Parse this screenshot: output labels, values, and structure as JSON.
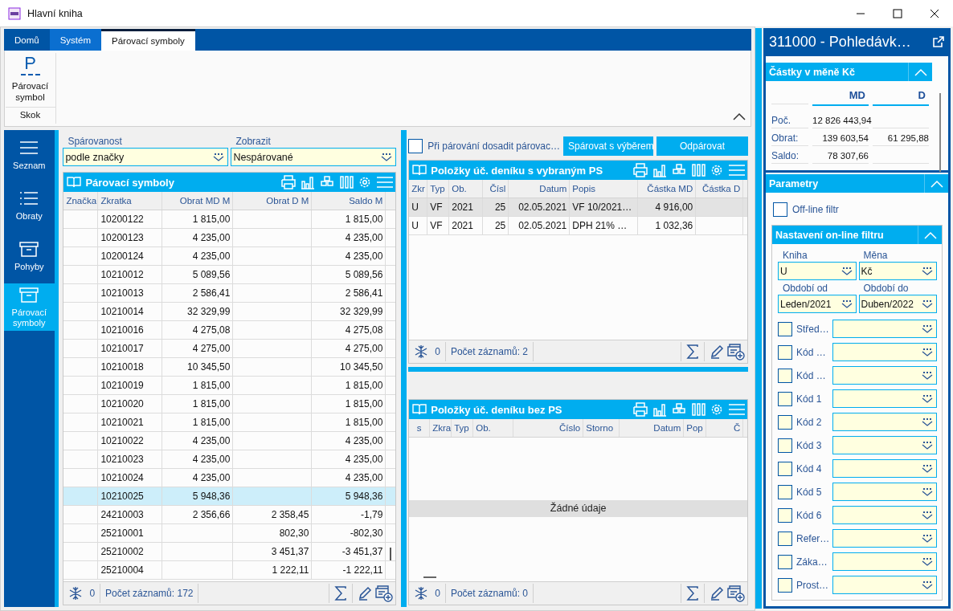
{
  "window": {
    "title": "Hlavní kniha"
  },
  "ribbon": {
    "tabs": [
      {
        "label": "Domů",
        "selected": false,
        "hovered": false
      },
      {
        "label": "Systém",
        "selected": false,
        "hovered": true
      },
      {
        "label": "Párovací symboly",
        "selected": true,
        "hovered": false
      }
    ],
    "groups": [
      {
        "label": "Skok",
        "buttons": [
          {
            "label": "Párovací symbol",
            "icon_text": "P"
          }
        ]
      }
    ]
  },
  "navigation": [
    {
      "label": "Seznam",
      "selected": false
    },
    {
      "label": "Obraty",
      "selected": false
    },
    {
      "label": "Pohyby",
      "selected": false
    },
    {
      "label": "Párovací symboly",
      "selected": true
    }
  ],
  "filters": [
    {
      "label": "Spárovanost",
      "value": "podle značky"
    },
    {
      "label": "Zobrazit",
      "value": "Nespárované"
    }
  ],
  "main_grid": {
    "title": "Párovací symboly",
    "columns": [
      "Značka",
      "Zkratka",
      "Obrat MD M",
      "Obrat D M",
      "Saldo M"
    ],
    "rows": [
      {
        "cells": [
          null,
          "10200122",
          "1 815,00",
          null,
          "1 815,00"
        ],
        "selected": false
      },
      {
        "cells": [
          null,
          "10200123",
          "4 235,00",
          null,
          "4 235,00"
        ],
        "selected": false
      },
      {
        "cells": [
          null,
          "10200124",
          "4 235,00",
          null,
          "4 235,00"
        ],
        "selected": false
      },
      {
        "cells": [
          null,
          "10210012",
          "5 089,56",
          null,
          "5 089,56"
        ],
        "selected": false
      },
      {
        "cells": [
          null,
          "10210013",
          "2 586,41",
          null,
          "2 586,41"
        ],
        "selected": false
      },
      {
        "cells": [
          null,
          "10210014",
          "32 329,99",
          null,
          "32 329,99"
        ],
        "selected": false
      },
      {
        "cells": [
          null,
          "10210016",
          "4 275,08",
          null,
          "4 275,08"
        ],
        "selected": false
      },
      {
        "cells": [
          null,
          "10210017",
          "4 275,00",
          null,
          "4 275,00"
        ],
        "selected": false
      },
      {
        "cells": [
          null,
          "10210018",
          "10 345,50",
          null,
          "10 345,50"
        ],
        "selected": false
      },
      {
        "cells": [
          null,
          "10210019",
          "1 815,00",
          null,
          "1 815,00"
        ],
        "selected": false
      },
      {
        "cells": [
          null,
          "10210020",
          "1 815,00",
          null,
          "1 815,00"
        ],
        "selected": false
      },
      {
        "cells": [
          null,
          "10210021",
          "1 815,00",
          null,
          "1 815,00"
        ],
        "selected": false
      },
      {
        "cells": [
          null,
          "10210022",
          "4 235,00",
          null,
          "4 235,00"
        ],
        "selected": false
      },
      {
        "cells": [
          null,
          "10210023",
          "4 235,00",
          null,
          "4 235,00"
        ],
        "selected": false
      },
      {
        "cells": [
          null,
          "10210024",
          "4 235,00",
          null,
          "4 235,00"
        ],
        "selected": false
      },
      {
        "cells": [
          null,
          "10210025",
          "5 948,36",
          null,
          "5 948,36"
        ],
        "selected": true
      },
      {
        "cells": [
          null,
          "24210003",
          "2 356,66",
          "2 358,45",
          "-1,79"
        ],
        "selected": false
      },
      {
        "cells": [
          null,
          "25210001",
          null,
          "802,30",
          "-802,30"
        ],
        "selected": false
      },
      {
        "cells": [
          null,
          "25210002",
          null,
          "3 451,37",
          "-3 451,37"
        ],
        "selected": false
      },
      {
        "cells": [
          null,
          "25210004",
          null,
          "1 222,11",
          "-1 222,11"
        ],
        "selected": false
      }
    ],
    "footer": {
      "count": "0",
      "records": "Počet záznamů: 172"
    }
  },
  "pairing": {
    "checkbox": {
      "label": "Při párování dosadit párovac…",
      "checked": false
    },
    "buttons": [
      "Spárovat s výběrem",
      "Odpárovat"
    ]
  },
  "selected_items_grid": {
    "title": "Položky úč. deníku s vybraným PS",
    "columns": [
      "Zkr",
      "Typ",
      "Ob.",
      "Čísl",
      "Datum",
      "Popis",
      "Částka MD",
      "Částka D"
    ],
    "rows": [
      {
        "cells": [
          "U",
          "VF",
          "2021",
          "25",
          "02.05.2021",
          "VF 10/2021…",
          "4 916,00",
          null
        ],
        "selected": true
      },
      {
        "cells": [
          "U",
          "VF",
          "2021",
          "25",
          "02.05.2021",
          "DPH 21% …",
          "1 032,36",
          null
        ],
        "selected": false
      }
    ],
    "footer": {
      "count": "0",
      "records": "Počet záznamů: 2"
    }
  },
  "unpaired_items_grid": {
    "title": "Položky úč. deníku bez PS",
    "columns": [
      "s",
      "Zkra",
      "Typ",
      "Ob.",
      "Číslo",
      "Storno",
      "Datum",
      "Pop",
      "Č"
    ],
    "empty_message": "Žádné údaje",
    "footer": {
      "count": "0",
      "records": "Počet záznamů: 0"
    }
  },
  "detail_panel": {
    "title": "311000 - Pohledávk…",
    "amounts": {
      "title": "Částky v měně Kč",
      "columns": [
        "MD",
        "D"
      ],
      "rows": [
        {
          "label": "Poč.",
          "md": "12 826 443,94"
        },
        {
          "label": "Obrat:",
          "md": "139 603,54",
          "d": "61 295,88"
        },
        {
          "label": "Saldo:",
          "md": "78 307,66"
        }
      ]
    },
    "parameters": {
      "title": "Parametry",
      "offline": {
        "label": "Off-line filtr",
        "checked": false
      },
      "online": {
        "title": "Nastavení on-line filtru",
        "fields": [
          {
            "label": "Kniha",
            "value": "U"
          },
          {
            "label": "Měna",
            "value": "Kč"
          },
          {
            "label": "Období od",
            "value": "Leden/2021"
          },
          {
            "label": "Období do",
            "value": "Duben/2022"
          }
        ],
        "filters": [
          {
            "label": "Střed…",
            "checked": false
          },
          {
            "label": "Kód …",
            "checked": false
          },
          {
            "label": "Kód …",
            "checked": false
          },
          {
            "label": "Kód 1",
            "checked": false
          },
          {
            "label": "Kód 2",
            "checked": false
          },
          {
            "label": "Kód 3",
            "checked": false
          },
          {
            "label": "Kód 4",
            "checked": false
          },
          {
            "label": "Kód 5",
            "checked": false
          },
          {
            "label": "Kód 6",
            "checked": false
          },
          {
            "label": "Refer…",
            "checked": false
          },
          {
            "label": "Záka…",
            "checked": false
          },
          {
            "label": "Prost…",
            "checked": false
          }
        ]
      }
    }
  }
}
